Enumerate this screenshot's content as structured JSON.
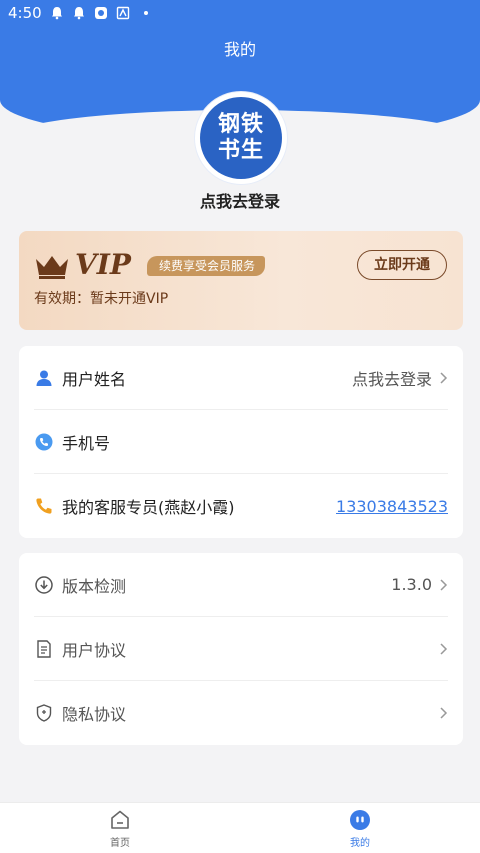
{
  "status_bar": {
    "time": "4:50"
  },
  "header": {
    "title": "我的"
  },
  "avatar": {
    "line1": "钢铁",
    "line2": "书生"
  },
  "profile": {
    "login_prompt": "点我去登录"
  },
  "vip": {
    "logo": "VIP",
    "tag": "续费享受会员服务",
    "open_button": "立即开通",
    "validity": "有效期：暂未开通VIP"
  },
  "user_info": {
    "rows": [
      {
        "label": "用户姓名",
        "value": "点我去登录",
        "icon": "user-icon"
      },
      {
        "label": "手机号",
        "value": "",
        "icon": "phone-circle-icon"
      },
      {
        "label": "我的客服专员(燕赵小霞)",
        "value": "13303843523",
        "icon": "phone-icon"
      }
    ]
  },
  "settings": {
    "rows": [
      {
        "label": "版本检测",
        "value": "1.3.0",
        "icon": "download-circle-icon"
      },
      {
        "label": "用户协议",
        "value": "",
        "icon": "document-icon"
      },
      {
        "label": "隐私协议",
        "value": "",
        "icon": "shield-icon"
      }
    ]
  },
  "tabbar": {
    "tabs": [
      {
        "label": "首页",
        "icon": "home-icon",
        "active": false
      },
      {
        "label": "我的",
        "icon": "profile-icon",
        "active": true
      }
    ]
  },
  "colors": {
    "primary": "#3a7be6",
    "vip_text": "#6b3a1a",
    "vip_tag": "#c7965c"
  }
}
